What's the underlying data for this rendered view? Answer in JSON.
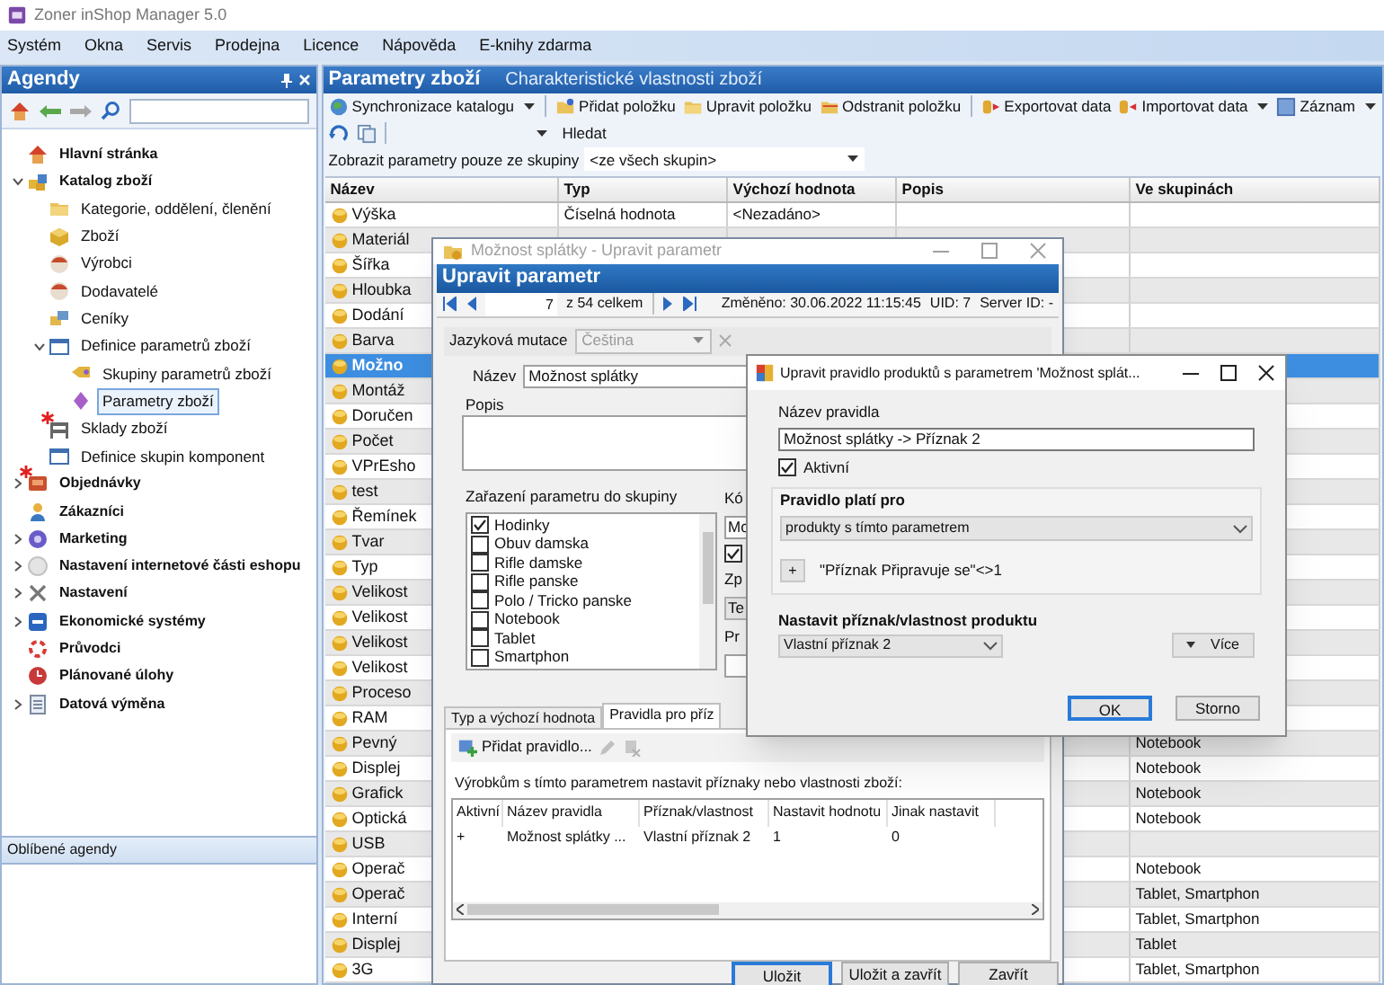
{
  "window": {
    "title": "Zoner inShop Manager 5.0"
  },
  "menu": [
    "Systém",
    "Okna",
    "Servis",
    "Prodejna",
    "Licence",
    "Nápověda",
    "E-knihy zdarma"
  ],
  "sidebar": {
    "title": "Agendy",
    "tree": [
      {
        "label": "Hlavní stránka",
        "selected": false,
        "flagged": false
      },
      {
        "label": "Katalog zboží",
        "expanded": true,
        "selected": false,
        "flagged": false,
        "children": [
          {
            "label": "Kategorie, oddělení, členění",
            "selected": false,
            "flagged": false
          },
          {
            "label": "Zboží",
            "selected": false,
            "flagged": false
          },
          {
            "label": "Výrobci",
            "selected": false,
            "flagged": false
          },
          {
            "label": "Dodavatelé",
            "selected": false,
            "flagged": false
          },
          {
            "label": "Ceníky",
            "selected": false,
            "flagged": false
          },
          {
            "label": "Definice parametrů zboží",
            "expanded": true,
            "selected": false,
            "flagged": false,
            "children": [
              {
                "label": "Skupiny parametrů zboží",
                "selected": false,
                "flagged": false
              },
              {
                "label": "Parametry zboží",
                "selected": true,
                "flagged": false
              }
            ]
          },
          {
            "label": "Sklady zboží",
            "selected": false,
            "flagged": true
          },
          {
            "label": "Definice skupin komponent",
            "selected": false,
            "flagged": false
          }
        ]
      },
      {
        "label": "Objednávky",
        "expanded": false,
        "selected": false,
        "flagged": true
      },
      {
        "label": "Zákazníci",
        "selected": false,
        "flagged": false
      },
      {
        "label": "Marketing",
        "expanded": false,
        "selected": false,
        "flagged": false
      },
      {
        "label": "Nastavení internetové části eshopu",
        "expanded": false,
        "selected": false,
        "flagged": false
      },
      {
        "label": "Nastavení",
        "expanded": false,
        "selected": false,
        "flagged": false
      },
      {
        "label": "Ekonomické systémy",
        "expanded": false,
        "selected": false,
        "flagged": false
      },
      {
        "label": "Průvodci",
        "selected": false,
        "flagged": false
      },
      {
        "label": "Plánované úlohy",
        "selected": false,
        "flagged": false
      },
      {
        "label": "Datová výměna",
        "expanded": false,
        "selected": false,
        "flagged": false
      }
    ],
    "favorites_title": "Oblíbené agendy"
  },
  "panel": {
    "title": "Parametry zboží",
    "subtitle": "Charakteristické vlastnosti zboží",
    "toolbar": [
      {
        "label": "Synchronizace katalogu",
        "dropdown": true,
        "separator_before": false
      },
      {
        "label": "Přidat položku",
        "dropdown": false,
        "separator_before": true
      },
      {
        "label": "Upravit položku",
        "dropdown": false,
        "separator_before": false
      },
      {
        "label": "Odstranit položku",
        "dropdown": false,
        "separator_before": false
      },
      {
        "label": "Exportovat data",
        "dropdown": false,
        "separator_before": true
      },
      {
        "label": "Importovat data",
        "dropdown": true,
        "separator_before": false
      },
      {
        "label": "Záznam",
        "dropdown": true,
        "separator_before": false
      }
    ],
    "search_button": "Hledat",
    "filter": {
      "label": "Zobrazit parametry pouze ze skupiny",
      "value": "<ze všech skupin>"
    },
    "table": {
      "columns": [
        "Název",
        "Typ",
        "Výchozí hodnota",
        "Popis",
        "Ve skupinách"
      ],
      "rows": [
        {
          "name": "Výška",
          "type": "Číselná hodnota",
          "default": "<Nezadáno>",
          "selected": false
        },
        {
          "name": "Materiál",
          "selected": false
        },
        {
          "name": "Šířka",
          "selected": false
        },
        {
          "name": "Hloubka",
          "selected": false
        },
        {
          "name": "Dodání",
          "selected": false
        },
        {
          "name": "Barva",
          "selected": false
        },
        {
          "name": "Možno",
          "selected": true
        },
        {
          "name": "Montáž",
          "selected": false
        },
        {
          "name": "Doručen",
          "selected": false
        },
        {
          "name": "Počet",
          "selected": false
        },
        {
          "name": "VPrEsho",
          "selected": false
        },
        {
          "name": "test",
          "selected": false
        },
        {
          "name": "Řemínek",
          "selected": false
        },
        {
          "name": "Tvar",
          "selected": false
        },
        {
          "name": "Typ",
          "selected": false
        },
        {
          "name": "Velikost",
          "selected": false
        },
        {
          "name": "Velikost",
          "selected": false
        },
        {
          "name": "Velikost",
          "selected": false
        },
        {
          "name": "Velikost",
          "selected": false
        },
        {
          "name": "Proceso",
          "selected": false
        },
        {
          "name": "RAM",
          "selected": false
        },
        {
          "name": "Pevný",
          "groups": "Notebook",
          "selected": false
        },
        {
          "name": "Displej",
          "groups": "Notebook",
          "selected": false
        },
        {
          "name": "Grafick",
          "groups": "Notebook",
          "selected": false
        },
        {
          "name": "Optická",
          "groups": "Notebook",
          "selected": false
        },
        {
          "name": "USB",
          "selected": false
        },
        {
          "name": "Operač",
          "groups": "Notebook",
          "selected": false
        },
        {
          "name": "Operač",
          "groups": "Tablet, Smartphon",
          "selected": false
        },
        {
          "name": "Interní",
          "groups": "Tablet, Smartphon",
          "selected": false
        },
        {
          "name": "Displej",
          "groups": "Tablet",
          "selected": false
        },
        {
          "name": "3G",
          "groups": "Tablet, Smartphon",
          "selected": false
        }
      ]
    }
  },
  "edit_dialog": {
    "title": "Možnost splátky - Upravit parametr",
    "header": "Upravit parametr",
    "record": "7",
    "record_total": "z 54 celkem",
    "changed": "Změněno: 30.06.2022 11:15:45",
    "uid": "UID: 7",
    "server_id": "Server ID: -",
    "language_label": "Jazyková mutace",
    "language": "Čeština",
    "language_disabled": true,
    "name_label": "Název",
    "name": "Možnost splátky",
    "description_label": "Popis",
    "groups_label": "Zařazení parametru do skupiny",
    "groups": [
      {
        "label": "Hodinky",
        "checked": true
      },
      {
        "label": "Obuv damska",
        "checked": false
      },
      {
        "label": "Rifle damske",
        "checked": false
      },
      {
        "label": "Rifle panske",
        "checked": false
      },
      {
        "label": "Polo / Tricko panske",
        "checked": false
      },
      {
        "label": "Notebook",
        "checked": false
      },
      {
        "label": "Tablet",
        "checked": false
      },
      {
        "label": "Smartphon",
        "checked": false
      }
    ],
    "side_fields": [
      {
        "kind": "label",
        "text": "Kó"
      },
      {
        "kind": "input",
        "text": "Mo"
      },
      {
        "kind": "checkbox",
        "checked": true
      },
      {
        "kind": "label",
        "text": "Zp"
      },
      {
        "kind": "select",
        "text": "Te"
      },
      {
        "kind": "label",
        "text": "Pr"
      },
      {
        "kind": "input"
      }
    ],
    "tabs": [
      {
        "label": "Typ a výchozí hodnota",
        "selected": false
      },
      {
        "label": "Pravidla pro příz",
        "selected": true
      }
    ],
    "add_rule": "Přidat pravidlo...",
    "rules_caption": "Výrobkům s tímto parametrem nastavit příznaky nebo vlastnosti zboží:",
    "rules_columns": [
      "Aktivní",
      "Název pravidla",
      "Příznak/vlastnost",
      "Nastavit hodnotu",
      "Jinak nastavit"
    ],
    "rules_rows": [
      {
        "cells": [
          "+",
          "Možnost splátky ...",
          "Vlastní příznak 2",
          "1",
          "0"
        ]
      }
    ],
    "buttons": [
      {
        "label": "Uložit",
        "default": true
      },
      {
        "label": "Uložit a zavřít",
        "default": false
      },
      {
        "label": "Zavřít",
        "default": false
      }
    ]
  },
  "rule_dialog": {
    "title": "Upravit pravidlo produktů s parametrem 'Možnost splát...",
    "name_label": "Název pravidla",
    "name": "Možnost splátky -> Příznak 2",
    "active": {
      "label": "Aktivní",
      "checked": true
    },
    "applies_label": "Pravidlo platí pro",
    "applies_value": "produkty s tímto parametrem",
    "condition_button": "+",
    "condition": "\"Příznak Připravuje se\"<>1",
    "set_label": "Nastavit příznak/vlastnost produktu",
    "set_value": "Vlastní příznak 2",
    "more_button": "Více",
    "buttons": [
      {
        "label": "OK",
        "default": true
      },
      {
        "label": "Storno",
        "default": false
      }
    ]
  }
}
